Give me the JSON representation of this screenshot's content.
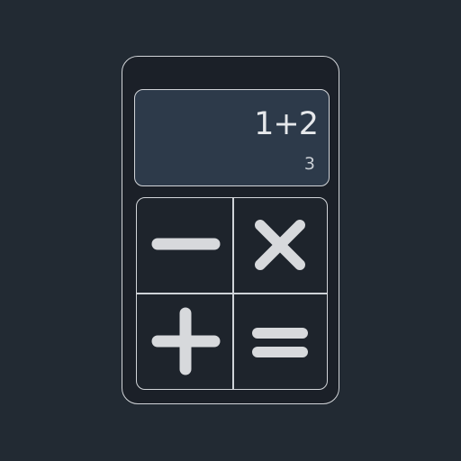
{
  "display": {
    "expression": "1+2",
    "result": "3"
  },
  "keypad": {
    "buttons": [
      {
        "symbol": "−",
        "icon": "minus-icon"
      },
      {
        "symbol": "×",
        "icon": "multiply-icon"
      },
      {
        "symbol": "+",
        "icon": "plus-icon"
      },
      {
        "symbol": "=",
        "icon": "equals-icon"
      }
    ]
  },
  "colors": {
    "background": "#222a33",
    "device": "#1b2028",
    "display": "#2d3a4a",
    "outline": "#d2d5d9",
    "text": "#e6e8eb",
    "icon": "#d7d9dc"
  }
}
